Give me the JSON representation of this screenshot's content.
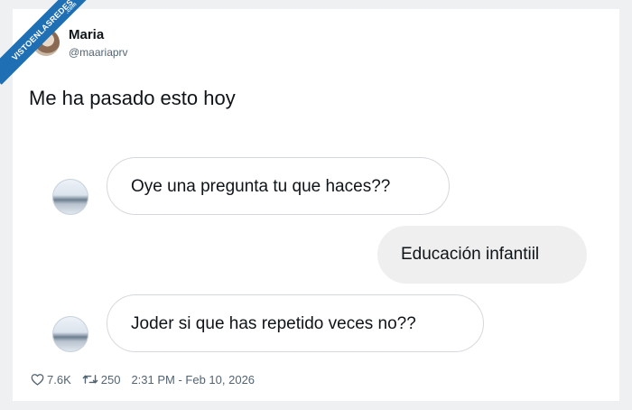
{
  "watermark": {
    "text": "VISTOENLASREDES",
    "suffix": ".com"
  },
  "author": {
    "name": "Maria",
    "handle": "@maariaprv"
  },
  "tweet": {
    "text": "Me ha pasado esto hoy"
  },
  "chat": {
    "messages": [
      {
        "side": "incoming",
        "text": "Oye una pregunta tu que haces??"
      },
      {
        "side": "outgoing",
        "text": "Educación infantiil"
      },
      {
        "side": "incoming",
        "text": "Joder si que has repetido veces no??"
      }
    ]
  },
  "footer": {
    "likes": "7.6K",
    "retweets": "250",
    "timestamp": "2:31 PM - Feb 10, 2026",
    "icons": {
      "like": "heart-icon",
      "retweet": "retweet-icon"
    }
  },
  "colors": {
    "ribbon": "#1f6fb5",
    "text": "#0f1419",
    "muted": "#536471",
    "outgoing_bubble": "#efefef"
  }
}
